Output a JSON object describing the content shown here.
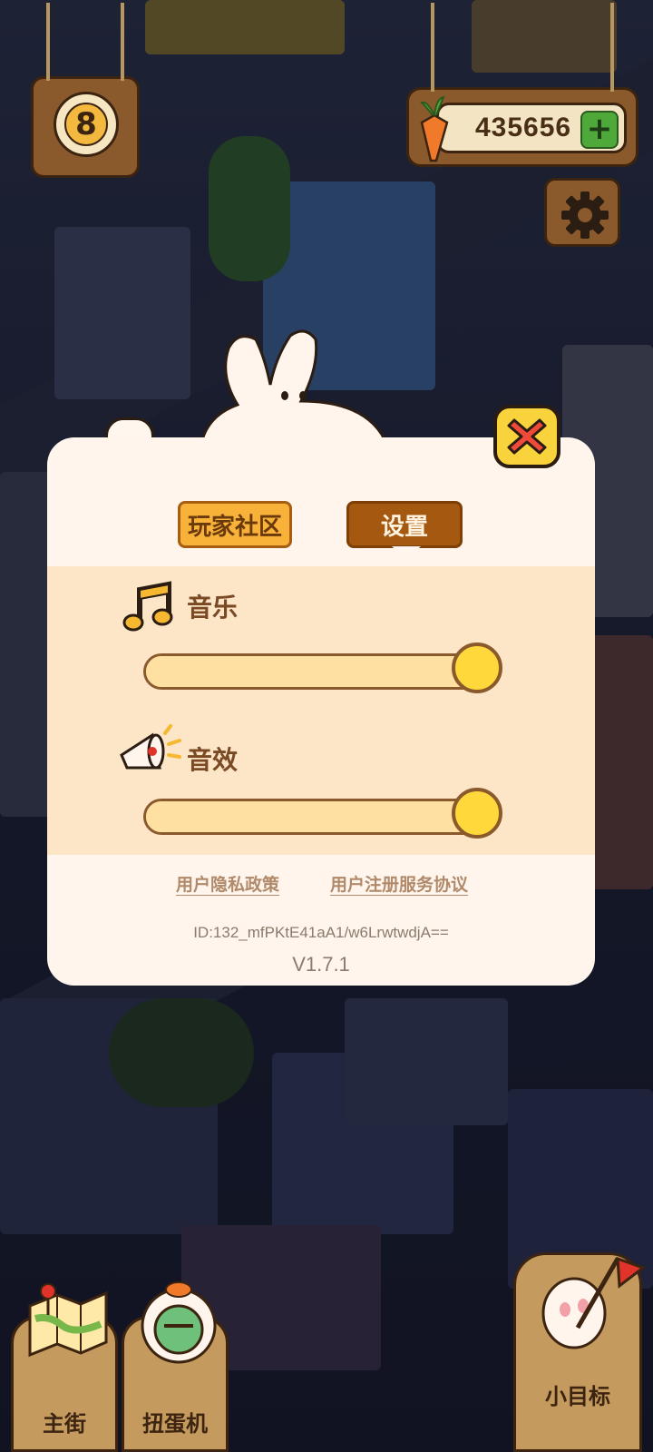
{
  "hud": {
    "level": "8",
    "currency_value": "435656",
    "currency_plus": "+"
  },
  "dialog": {
    "tabs": [
      {
        "label": "玩家社区",
        "active": false
      },
      {
        "label": "设置",
        "active": true
      }
    ],
    "music": {
      "label": "音乐",
      "level": 1.0
    },
    "sfx": {
      "label": "音效",
      "level": 1.0
    },
    "links": {
      "privacy": "用户隐私政策",
      "agreement": "用户注册服务协议"
    },
    "user_id": "ID:132_mfPKtE41aA1/w6LrwtwdjA==",
    "version": "V1.7.1"
  },
  "bottom_nav": {
    "main_street": "主街",
    "gacha": "扭蛋机",
    "goals": "小目标"
  },
  "colors": {
    "panel_bg": "#fff5ec",
    "panel_band": "#fde6c8",
    "tab_active": "#a5580f",
    "tab_inactive": "#f8b23a",
    "slider_knob": "#ffd83c",
    "close_button": "#f8d33c",
    "close_x": "#f04a3a"
  },
  "icons": [
    "carrot-icon",
    "plus-icon",
    "gear-icon",
    "close-icon",
    "music-note-icon",
    "megaphone-icon",
    "map-icon",
    "gacha-icon",
    "flag-icon"
  ]
}
